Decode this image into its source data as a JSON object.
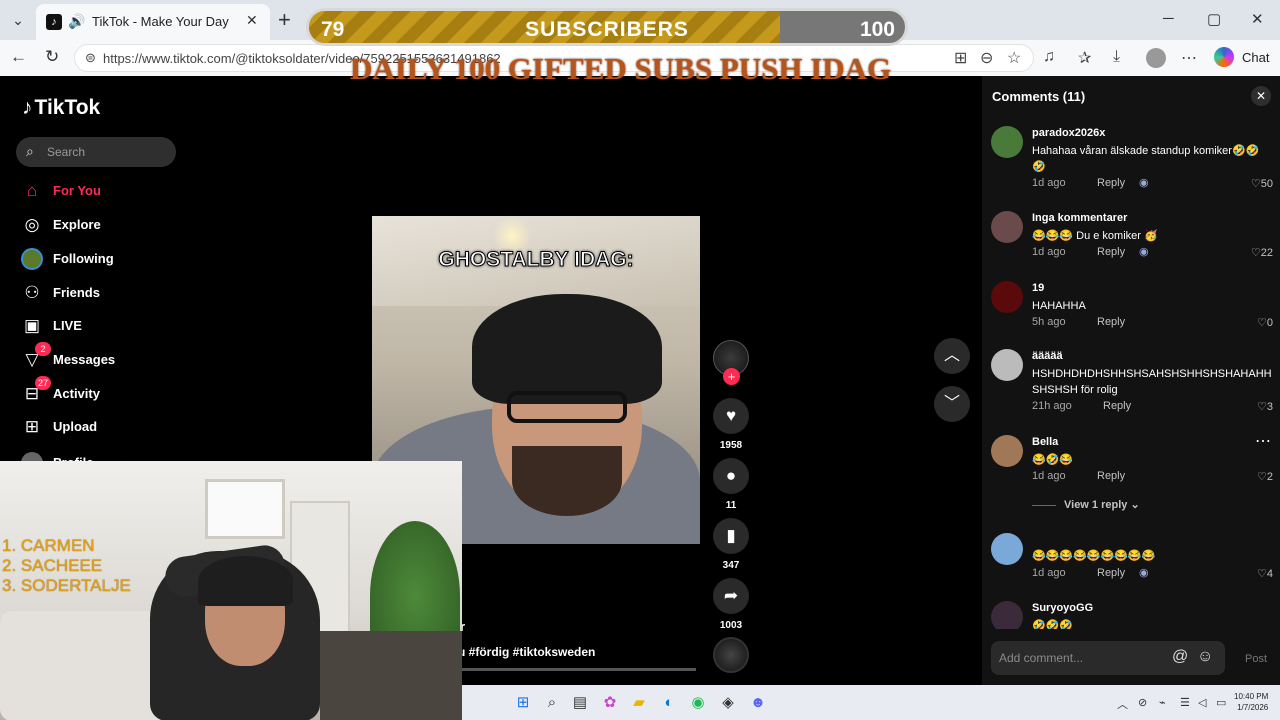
{
  "browser": {
    "tab_title": "TikTok - Make Your Day",
    "url": "https://www.tiktok.com/@tiktoksoldater/video/7592251552631491862",
    "chat_label": "Chat"
  },
  "stream_overlay": {
    "subs_current": "79",
    "subs_label": "SUBSCRIBERS",
    "subs_goal": "100",
    "progress_fraction": 0.79,
    "banner": "DAILY 100  GIFTED SUBS PUSH IDAG",
    "webcam_list": [
      "1. CARMEN",
      "2. SACHEEE",
      "3. SODERTALJE"
    ]
  },
  "tiktok": {
    "logo": "TikTok",
    "search_placeholder": "Search",
    "nav": [
      {
        "label": "For You",
        "icon": "home-icon",
        "active": true
      },
      {
        "label": "Explore",
        "icon": "compass-icon"
      },
      {
        "label": "Following",
        "icon": "following-avatar-icon"
      },
      {
        "label": "Friends",
        "icon": "friends-icon"
      },
      {
        "label": "LIVE",
        "icon": "live-tv-icon"
      },
      {
        "label": "Messages",
        "icon": "send-icon",
        "badge": "2"
      },
      {
        "label": "Activity",
        "icon": "inbox-icon",
        "badge": "27"
      },
      {
        "label": "Upload",
        "icon": "plus-square-icon"
      },
      {
        "label": "Profile",
        "icon": "profile-avatar-icon"
      }
    ],
    "video": {
      "caption": "GHOSTALBY IDAG:",
      "author_fragment": "r",
      "hashtags": "u #fördig #tiktoksweden"
    },
    "actions": {
      "likes": "1958",
      "comments": "11",
      "saves": "347",
      "shares": "1003"
    }
  },
  "comments_panel": {
    "title": "Comments (11)",
    "comments": [
      {
        "user": "paradox2026x",
        "text": "Hahahaa våran älskade standup komiker🤣🤣🤣",
        "time": "1d ago",
        "likes": "50",
        "creator_liked": true,
        "avatar_color": "#4a7a3a"
      },
      {
        "user": "Inga kommentarer",
        "text": "😂😂😂 Du e komiker 🥳",
        "time": "1d ago",
        "likes": "22",
        "creator_liked": true,
        "avatar_color": "#6a4a4a"
      },
      {
        "user": "19",
        "text": "HAHAHHA",
        "time": "5h ago",
        "likes": "0",
        "creator_liked": false,
        "avatar_color": "#5a0a0a"
      },
      {
        "user": "äääää",
        "text": "HSHDHDHDHSHHSHSAHSHSHHSHSHAHAHHSHSHSH för rolig",
        "time": "21h ago",
        "likes": "3",
        "creator_liked": false,
        "avatar_color": "#bbbbbb"
      },
      {
        "user": "Bella",
        "text": "😂🤣😂",
        "time": "1d ago",
        "likes": "2",
        "creator_liked": false,
        "avatar_color": "#a07858"
      },
      {
        "user": "",
        "text": "😂😂😂😂😂😂😂😂😂",
        "time": "1d ago",
        "likes": "4",
        "creator_liked": true,
        "avatar_color": "#7aa8d8"
      },
      {
        "user": "SuryoyoGG",
        "text": "🤣🤣🤣",
        "time": "",
        "likes": "",
        "creator_liked": false,
        "avatar_color": "#3a2a3a"
      }
    ],
    "reply_label": "Reply",
    "view_replies": "View 1 reply ⌄",
    "input_placeholder": "Add comment...",
    "post_label": "Post"
  },
  "taskbar": {
    "time": "10:40 PM",
    "date": "1/7/2026"
  },
  "colors": {
    "tiktok_accent": "#fe2c55",
    "sub_bar_fill": "#c59a1c",
    "banner_text": "#b5541b",
    "webcam_list_text": "#e3a21a"
  }
}
